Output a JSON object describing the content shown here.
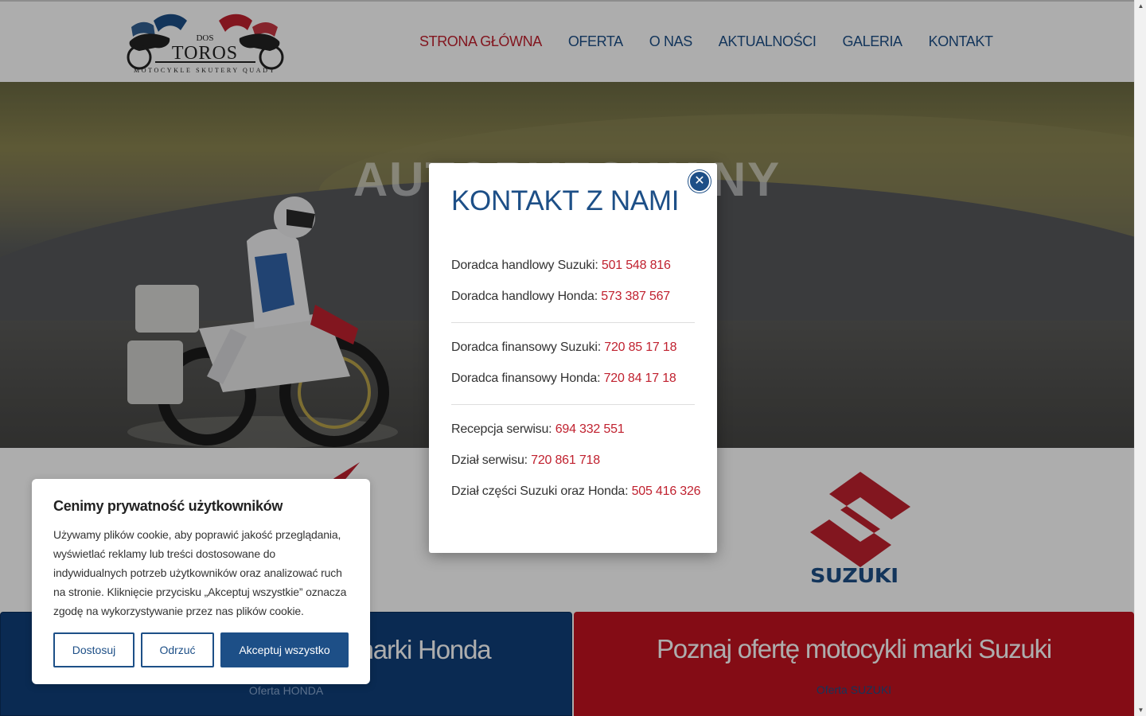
{
  "logo": {
    "small_text": "DOS",
    "title": "TOROS",
    "subtitle": "MOTOCYKLE SKUTERY QUADY"
  },
  "nav": {
    "items": [
      {
        "label": "STRONA GŁÓWNA",
        "active": true
      },
      {
        "label": "OFERTA",
        "active": false
      },
      {
        "label": "O NAS",
        "active": false
      },
      {
        "label": "AKTUALNOŚCI",
        "active": false
      },
      {
        "label": "GALERIA",
        "active": false
      },
      {
        "label": "KONTAKT",
        "active": false
      }
    ]
  },
  "hero": {
    "title": "AUTORYZOWANY"
  },
  "brands": {
    "suzuki_word": "SUZUKI"
  },
  "panels": {
    "honda": {
      "title": "Poznaj ofertę motocykli marki Honda",
      "link": "Oferta HONDA"
    },
    "suzuki": {
      "title": "Poznaj ofertę motocykli marki Suzuki",
      "link": "Oferta SUZUKI"
    }
  },
  "modal": {
    "title": "KONTAKT Z NAMI",
    "close_icon": "close-icon",
    "contacts": [
      {
        "label": "Doradca handlowy Suzuki:",
        "phone": "501 548 816"
      },
      {
        "label": "Doradca handlowy Honda:",
        "phone": "573 387 567"
      },
      {
        "label": "Doradca finansowy Suzuki:",
        "phone": "720 85 17 18"
      },
      {
        "label": "Doradca finansowy Honda:",
        "phone": "720 84 17 18"
      },
      {
        "label": "Recepcja serwisu:",
        "phone": "694 332 551"
      },
      {
        "label": "Dział serwisu:",
        "phone": "720 861 718"
      },
      {
        "label": "Dział części Suzuki oraz Honda:",
        "phone": "505 416 326"
      }
    ]
  },
  "cookie": {
    "title": "Cenimy prywatność użytkowników",
    "text": "Używamy plików cookie, aby poprawić jakość przeglądania, wyświetlać reklamy lub treści dostosowane do indywidualnych potrzeb użytkowników oraz analizować ruch na stronie. Kliknięcie przycisku „Akceptuj wszystkie” oznacza zgodę na wykorzystywanie przez nas plików cookie.",
    "customize_label": "Dostosuj",
    "reject_label": "Odrzuć",
    "accept_label": "Akceptuj wszystko"
  },
  "colors": {
    "brand_blue": "#1d4f87",
    "brand_red": "#c0212f",
    "honda_panel": "#0f3e7a",
    "suzuki_panel": "#c3121f"
  }
}
